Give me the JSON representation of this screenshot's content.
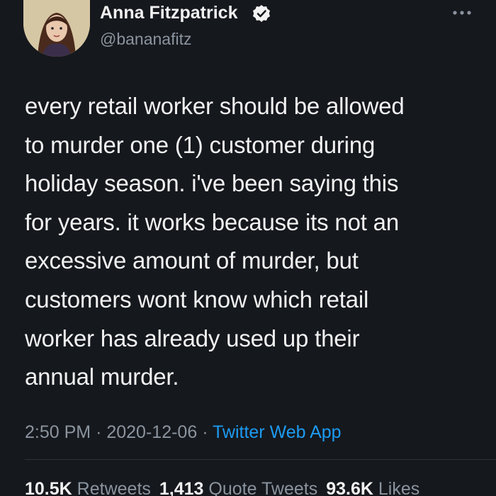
{
  "author": {
    "name": "Anna Fitzpatrick",
    "handle": "@bananafitz",
    "verified": true,
    "avatar_icon": "profile-illustration"
  },
  "tweet": {
    "lines": [
      "every retail worker should be allowed",
      "to murder one (1) customer during",
      "holiday season. i've been saying this",
      "for years. it works because its not an",
      "excessive amount of murder, but",
      "customers wont know which retail",
      "worker has already used up their",
      "annual murder."
    ],
    "time": "2:50 PM",
    "separator": "·",
    "date": "2020-12-06",
    "source": "Twitter Web App"
  },
  "stats": {
    "retweets_count": "10.5K",
    "retweets_label": "Retweets",
    "quote_count": "1,413",
    "quote_label": "Quote Tweets",
    "likes_count": "93.6K",
    "likes_label": "Likes"
  },
  "colors": {
    "background": "#15181d",
    "text": "#f2f2f2",
    "secondary": "#8b949e",
    "accent": "#1d9bf0"
  }
}
